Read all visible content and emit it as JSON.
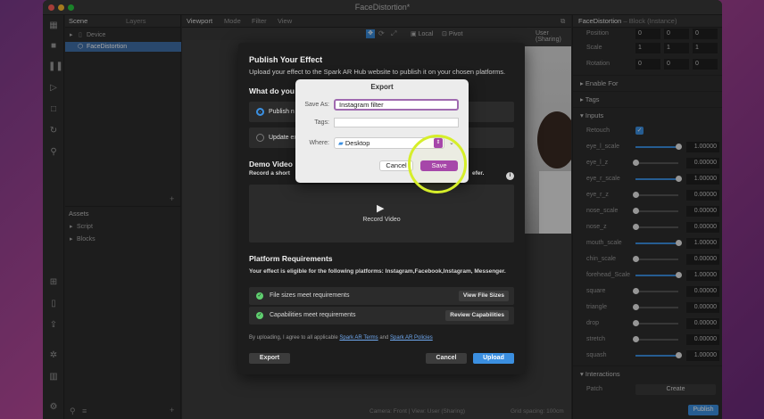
{
  "window": {
    "title": "FaceDistortion*"
  },
  "scene_panel": {
    "tabs": [
      "Scene",
      "Layers"
    ],
    "tree": [
      {
        "label": "Device"
      },
      {
        "label": "FaceDistortion"
      }
    ],
    "assets_title": "Assets",
    "assets": [
      "Script",
      "Blocks"
    ],
    "add_symbol": "+"
  },
  "viewport": {
    "tabs": [
      "Viewport",
      "Mode",
      "Filter",
      "View"
    ],
    "local_label": "Local",
    "pivot_label": "Pivot",
    "camera_select": "User (Sharing)",
    "status_left": "Camera: Front | View: User (Sharing)",
    "status_right": "Grid spacing: 100cm"
  },
  "inspector": {
    "title": "FaceDistortion",
    "subtitle": "– Block (Instance)",
    "transform": [
      {
        "label": "Position",
        "values": [
          "0",
          "0",
          "0"
        ]
      },
      {
        "label": "Scale",
        "values": [
          "1",
          "1",
          "1"
        ]
      },
      {
        "label": "Rotation",
        "values": [
          "0",
          "0",
          "0"
        ]
      }
    ],
    "sections": [
      "Enable For",
      "Tags",
      "Inputs",
      "Interactions"
    ],
    "retouch_label": "Retouch",
    "inputs": [
      {
        "label": "eye_l_scale",
        "value": "1.00000",
        "level": 1.0
      },
      {
        "label": "eye_l_z",
        "value": "0.00000",
        "level": 0.0
      },
      {
        "label": "eye_r_scale",
        "value": "1.00000",
        "level": 1.0
      },
      {
        "label": "eye_r_z",
        "value": "0.00000",
        "level": 0.0
      },
      {
        "label": "nose_scale",
        "value": "0.00000",
        "level": 0.0
      },
      {
        "label": "nose_z",
        "value": "0.00000",
        "level": 0.0
      },
      {
        "label": "mouth_scale",
        "value": "1.00000",
        "level": 1.0
      },
      {
        "label": "chin_scale",
        "value": "0.00000",
        "level": 0.0
      },
      {
        "label": "forehead_Scale",
        "value": "1.00000",
        "level": 1.0
      },
      {
        "label": "square",
        "value": "0.00000",
        "level": 0.0
      },
      {
        "label": "triangle",
        "value": "0.00000",
        "level": 0.0
      },
      {
        "label": "drop",
        "value": "0.00000",
        "level": 0.0
      },
      {
        "label": "stretch",
        "value": "0.00000",
        "level": 0.0
      },
      {
        "label": "squash",
        "value": "1.00000",
        "level": 1.0
      }
    ],
    "patch_label": "Patch",
    "create_label": "Create",
    "publish_label": "Publish"
  },
  "publish_dialog": {
    "title": "Publish Your Effect",
    "subtitle": "Upload your effect to the Spark AR Hub website to publish it on your chosen platforms.",
    "question": "What do you",
    "option_publish": "Publish n",
    "option_update": "Update ex",
    "demo_title": "Demo Video",
    "demo_desc": "Record a short",
    "demo_desc_end": "efer.",
    "record_label": "Record Video",
    "req_title": "Platform Requirements",
    "req_desc": "Your effect is eligible for the following platforms: Instagram,Facebook,Instagram, Messenger.",
    "requirements": [
      {
        "text": "File sizes meet requirements",
        "button": "View File Sizes"
      },
      {
        "text": "Capabilities meet requirements",
        "button": "Review Capabilities"
      }
    ],
    "agree_prefix": "By uploading, I agree to all applicable",
    "terms_link": "Spark AR Terms",
    "and": "and",
    "policies_link": "Spark AR Policies",
    "export_label": "Export",
    "cancel_label": "Cancel",
    "upload_label": "Upload"
  },
  "export_dialog": {
    "title": "Export",
    "save_as_label": "Save As:",
    "save_as_value": "Instagram filter",
    "tags_label": "Tags:",
    "tags_value": "",
    "where_label": "Where:",
    "where_value": "Desktop",
    "cancel_label": "Cancel",
    "save_label": "Save"
  },
  "colors": {
    "accent_blue": "#3b8fe0",
    "save_purple": "#a43fb0",
    "highlight_ring": "#d6ee2a",
    "check_green": "#5fcf6f"
  }
}
